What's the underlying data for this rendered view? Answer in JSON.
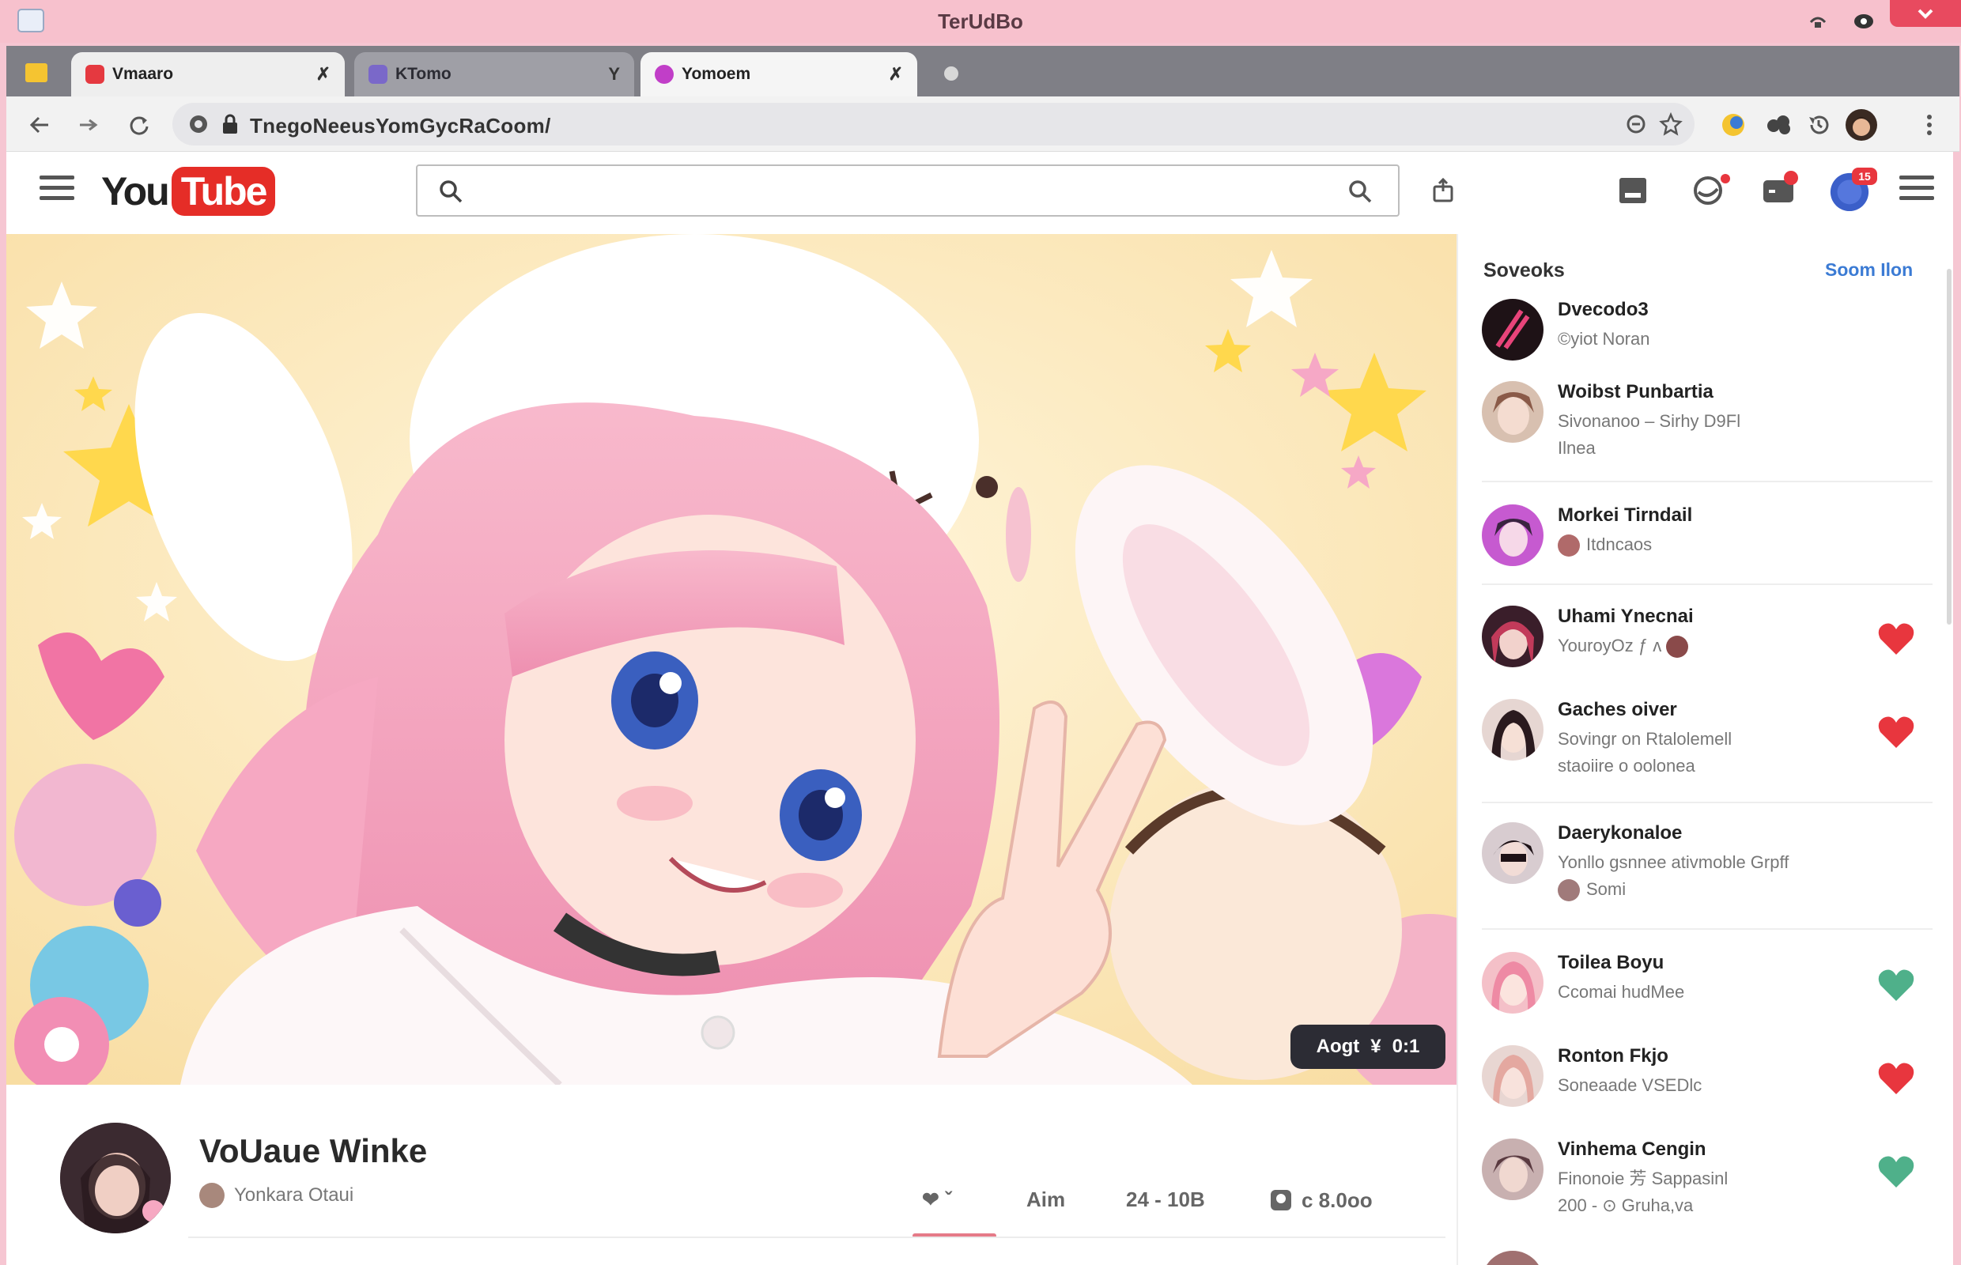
{
  "window": {
    "title": "TerUdBo"
  },
  "tabs": [
    {
      "label": "Vmaaro",
      "close": "✗",
      "favicon_color": "#e53940"
    },
    {
      "label": "KTomo",
      "close": "Y",
      "favicon_color": "#7a68c9"
    },
    {
      "label": "Yomoem",
      "close": "✗",
      "favicon_color": "#c13ec8"
    }
  ],
  "address": {
    "url": "TnegoNeeusYomGycRaCoom/"
  },
  "yt": {
    "logo_you": "You",
    "logo_tube": "Tube",
    "avatar_badge": "15"
  },
  "video": {
    "duration_left": "Aogt",
    "duration_icon": "¥",
    "duration_right": "0:1",
    "title": "VoUaue Winke",
    "channel": "Yonkara Otaui",
    "actions": {
      "like": "❤ ˇ",
      "aim": "Aim",
      "count": "24 - 10B",
      "share": "c 8.0oo"
    }
  },
  "sidebar": {
    "header": "Soveoks",
    "link": "Soom Ilon",
    "items": [
      {
        "name": "Dvecodo3",
        "line1": "©yiot Noran",
        "line2": "",
        "heart": "",
        "avatar_color": "#2a1a22"
      },
      {
        "name": "Woibst Punbartia",
        "line1": "Sivonanoo – Sirhy D9Fl",
        "line2": "Ilnea",
        "heart": "",
        "avatar_color": "#c9a48e"
      },
      {
        "name": "Morkei Tirndail",
        "line1": "Itdncaos",
        "line2": "",
        "heart": "",
        "avatar_color": "#b14ab8"
      },
      {
        "name": "Uhami Ynecnai",
        "line1": "YouroyOz  ƒ  ʌ",
        "line2": "",
        "heart": "red",
        "avatar_color": "#5a2a38"
      },
      {
        "name": "Gaches oiver",
        "line1": "Sovingr on Rtalolemell",
        "line2": "staoiire o oolonea",
        "heart": "red",
        "avatar_color": "#3c2a2c"
      },
      {
        "name": "Daerykonaloe",
        "line1": "Yonllo gsnnee ativmoble Grpff",
        "line2": "Somi",
        "heart": "",
        "avatar_color": "#4a3238"
      },
      {
        "name": "Toilea Boyu",
        "line1": "Ccomai hudMee",
        "line2": "",
        "heart": "green",
        "avatar_color": "#e89aa6"
      },
      {
        "name": "Ronton Fkjo",
        "line1": "Soneaade VSEDlc",
        "line2": "",
        "heart": "red",
        "avatar_color": "#d4b0a8"
      },
      {
        "name": "Vinhema Cengin",
        "line1": "Finonoie 芳 Sappasinl",
        "line2": "200 - ⊙ Gruha,va",
        "heart": "green",
        "avatar_color": "#8a6a6e"
      }
    ]
  },
  "colors": {
    "titlebar": "#f7c1cd",
    "accent_red": "#e53940",
    "heart_red": "#e8363e",
    "heart_green": "#4fb08a",
    "link_blue": "#3b7bd4"
  }
}
